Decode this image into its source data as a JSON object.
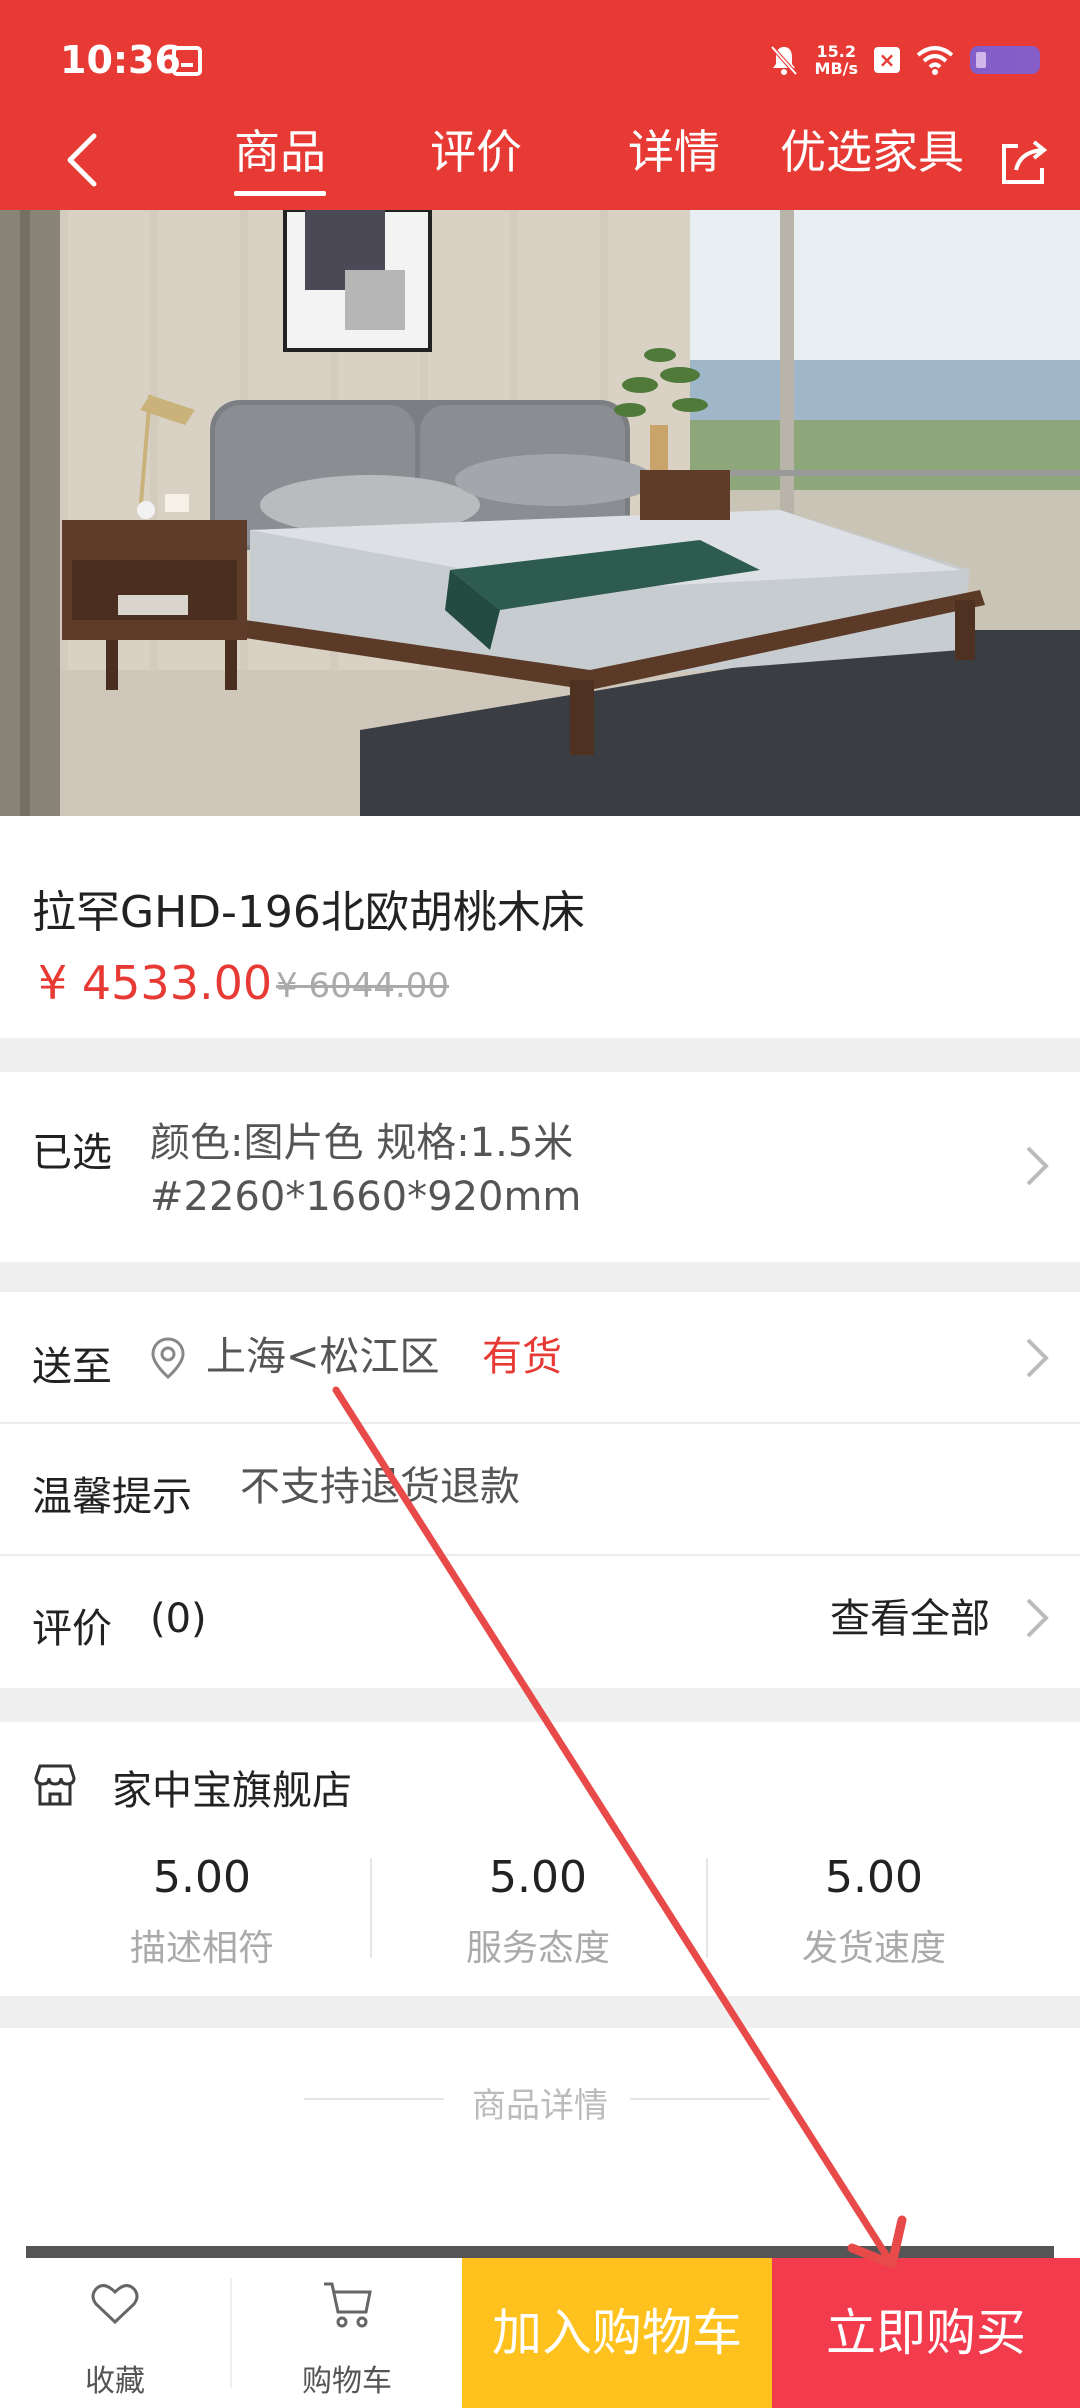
{
  "status_bar": {
    "time": "10:36",
    "net_speed_value": "15.2",
    "net_speed_unit": "MB/s"
  },
  "nav": {
    "tabs": [
      "商品",
      "评价",
      "详情",
      "优选家具"
    ],
    "active_tab": "商品"
  },
  "product": {
    "title": "拉罕GHD-196北欧胡桃木床",
    "price": "¥ 4533.00",
    "original_price": "¥ 6044.00"
  },
  "selected": {
    "label": "已选",
    "line1": "颜色:图片色 规格:1.5米",
    "line2": "#2260*1660*920mm"
  },
  "delivery": {
    "label": "送至",
    "location": "上海<松江区",
    "stock": "有货"
  },
  "notice": {
    "label": "温馨提示",
    "text": "不支持退货退款"
  },
  "reviews": {
    "label": "评价",
    "count": "(0)",
    "view_all": "查看全部"
  },
  "store": {
    "name": "家中宝旗舰店",
    "scores": [
      {
        "value": "5.00",
        "label": "描述相符"
      },
      {
        "value": "5.00",
        "label": "服务态度"
      },
      {
        "value": "5.00",
        "label": "发货速度"
      }
    ]
  },
  "details_section": {
    "title": "商品详情"
  },
  "bottom_bar": {
    "favorite": "收藏",
    "cart": "购物车",
    "add_to_cart": "加入购物车",
    "buy_now": "立即购买"
  },
  "colors": {
    "brand_red": "#e83a35",
    "cart_yellow": "#ffc11e",
    "buy_red": "#f23b4c",
    "annotation_arrow": "#e84a4a"
  }
}
